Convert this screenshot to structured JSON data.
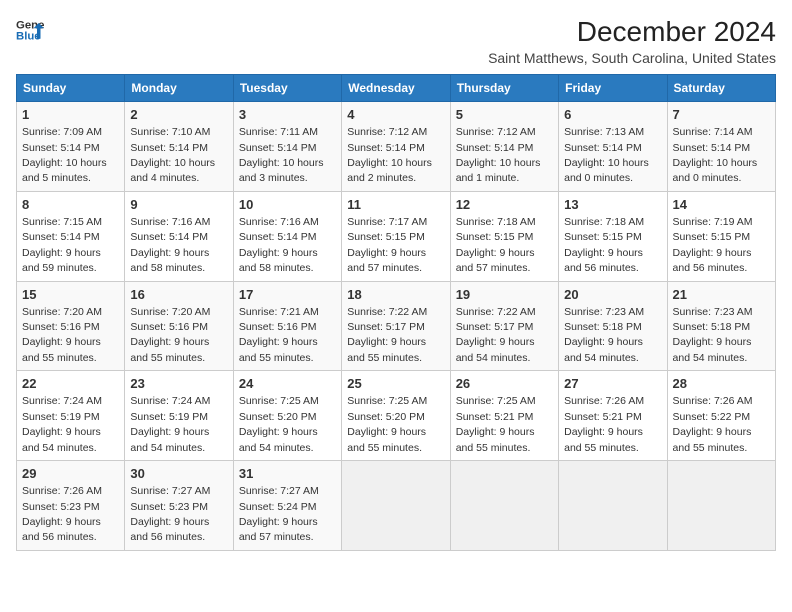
{
  "header": {
    "logo_line1": "General",
    "logo_line2": "Blue",
    "title": "December 2024",
    "subtitle": "Saint Matthews, South Carolina, United States"
  },
  "days_of_week": [
    "Sunday",
    "Monday",
    "Tuesday",
    "Wednesday",
    "Thursday",
    "Friday",
    "Saturday"
  ],
  "weeks": [
    [
      {
        "day": 1,
        "sunrise": "7:09 AM",
        "sunset": "5:14 PM",
        "daylight": "10 hours and 5 minutes."
      },
      {
        "day": 2,
        "sunrise": "7:10 AM",
        "sunset": "5:14 PM",
        "daylight": "10 hours and 4 minutes."
      },
      {
        "day": 3,
        "sunrise": "7:11 AM",
        "sunset": "5:14 PM",
        "daylight": "10 hours and 3 minutes."
      },
      {
        "day": 4,
        "sunrise": "7:12 AM",
        "sunset": "5:14 PM",
        "daylight": "10 hours and 2 minutes."
      },
      {
        "day": 5,
        "sunrise": "7:12 AM",
        "sunset": "5:14 PM",
        "daylight": "10 hours and 1 minute."
      },
      {
        "day": 6,
        "sunrise": "7:13 AM",
        "sunset": "5:14 PM",
        "daylight": "10 hours and 0 minutes."
      },
      {
        "day": 7,
        "sunrise": "7:14 AM",
        "sunset": "5:14 PM",
        "daylight": "10 hours and 0 minutes."
      }
    ],
    [
      {
        "day": 8,
        "sunrise": "7:15 AM",
        "sunset": "5:14 PM",
        "daylight": "9 hours and 59 minutes."
      },
      {
        "day": 9,
        "sunrise": "7:16 AM",
        "sunset": "5:14 PM",
        "daylight": "9 hours and 58 minutes."
      },
      {
        "day": 10,
        "sunrise": "7:16 AM",
        "sunset": "5:14 PM",
        "daylight": "9 hours and 58 minutes."
      },
      {
        "day": 11,
        "sunrise": "7:17 AM",
        "sunset": "5:15 PM",
        "daylight": "9 hours and 57 minutes."
      },
      {
        "day": 12,
        "sunrise": "7:18 AM",
        "sunset": "5:15 PM",
        "daylight": "9 hours and 57 minutes."
      },
      {
        "day": 13,
        "sunrise": "7:18 AM",
        "sunset": "5:15 PM",
        "daylight": "9 hours and 56 minutes."
      },
      {
        "day": 14,
        "sunrise": "7:19 AM",
        "sunset": "5:15 PM",
        "daylight": "9 hours and 56 minutes."
      }
    ],
    [
      {
        "day": 15,
        "sunrise": "7:20 AM",
        "sunset": "5:16 PM",
        "daylight": "9 hours and 55 minutes."
      },
      {
        "day": 16,
        "sunrise": "7:20 AM",
        "sunset": "5:16 PM",
        "daylight": "9 hours and 55 minutes."
      },
      {
        "day": 17,
        "sunrise": "7:21 AM",
        "sunset": "5:16 PM",
        "daylight": "9 hours and 55 minutes."
      },
      {
        "day": 18,
        "sunrise": "7:22 AM",
        "sunset": "5:17 PM",
        "daylight": "9 hours and 55 minutes."
      },
      {
        "day": 19,
        "sunrise": "7:22 AM",
        "sunset": "5:17 PM",
        "daylight": "9 hours and 54 minutes."
      },
      {
        "day": 20,
        "sunrise": "7:23 AM",
        "sunset": "5:18 PM",
        "daylight": "9 hours and 54 minutes."
      },
      {
        "day": 21,
        "sunrise": "7:23 AM",
        "sunset": "5:18 PM",
        "daylight": "9 hours and 54 minutes."
      }
    ],
    [
      {
        "day": 22,
        "sunrise": "7:24 AM",
        "sunset": "5:19 PM",
        "daylight": "9 hours and 54 minutes."
      },
      {
        "day": 23,
        "sunrise": "7:24 AM",
        "sunset": "5:19 PM",
        "daylight": "9 hours and 54 minutes."
      },
      {
        "day": 24,
        "sunrise": "7:25 AM",
        "sunset": "5:20 PM",
        "daylight": "9 hours and 54 minutes."
      },
      {
        "day": 25,
        "sunrise": "7:25 AM",
        "sunset": "5:20 PM",
        "daylight": "9 hours and 55 minutes."
      },
      {
        "day": 26,
        "sunrise": "7:25 AM",
        "sunset": "5:21 PM",
        "daylight": "9 hours and 55 minutes."
      },
      {
        "day": 27,
        "sunrise": "7:26 AM",
        "sunset": "5:21 PM",
        "daylight": "9 hours and 55 minutes."
      },
      {
        "day": 28,
        "sunrise": "7:26 AM",
        "sunset": "5:22 PM",
        "daylight": "9 hours and 55 minutes."
      }
    ],
    [
      {
        "day": 29,
        "sunrise": "7:26 AM",
        "sunset": "5:23 PM",
        "daylight": "9 hours and 56 minutes."
      },
      {
        "day": 30,
        "sunrise": "7:27 AM",
        "sunset": "5:23 PM",
        "daylight": "9 hours and 56 minutes."
      },
      {
        "day": 31,
        "sunrise": "7:27 AM",
        "sunset": "5:24 PM",
        "daylight": "9 hours and 57 minutes."
      },
      null,
      null,
      null,
      null
    ]
  ]
}
